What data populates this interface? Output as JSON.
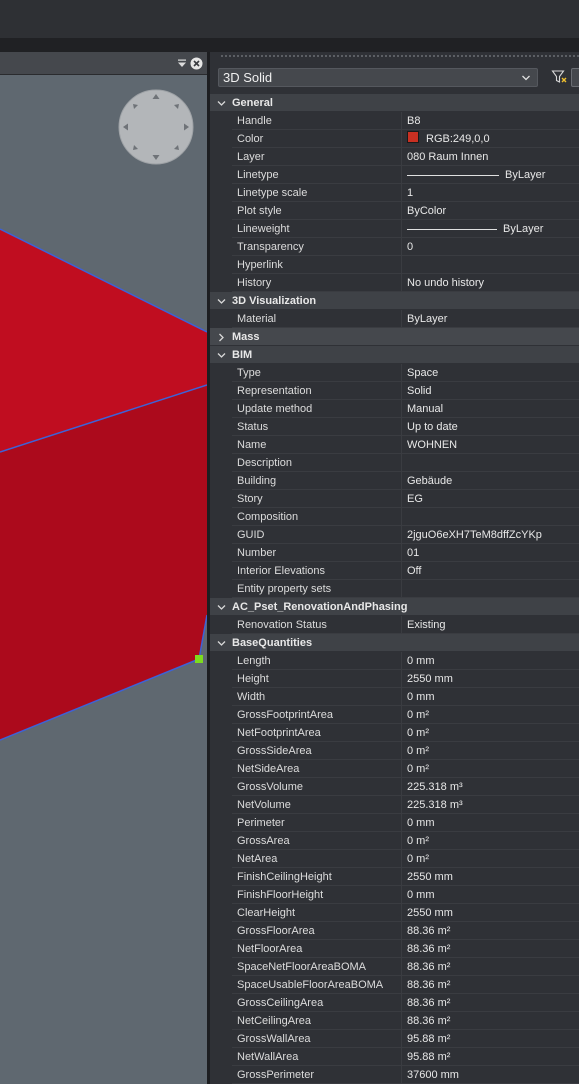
{
  "viewport": {
    "solid_color": "#c00d20",
    "edge_color": "#3d62d8",
    "background": "#5f6870"
  },
  "properties": {
    "selector_value": "3D Solid",
    "sections": [
      {
        "label": "General",
        "expanded": true,
        "rows": [
          {
            "name": "Handle",
            "value": "B8",
            "disabled": true
          },
          {
            "name": "Color",
            "value": "RGB:249,0,0",
            "swatch": "#c93022"
          },
          {
            "name": "Layer",
            "value": "080 Raum Innen"
          },
          {
            "name": "Linetype",
            "value": "ByLayer",
            "line": true
          },
          {
            "name": "Linetype scale",
            "value": "1"
          },
          {
            "name": "Plot style",
            "value": "ByColor",
            "disabled": true
          },
          {
            "name": "Lineweight",
            "value": "ByLayer",
            "line": true
          },
          {
            "name": "Transparency",
            "value": "0"
          },
          {
            "name": "Hyperlink",
            "value": ""
          },
          {
            "name": "History",
            "value": "No undo history"
          }
        ]
      },
      {
        "label": "3D Visualization",
        "expanded": true,
        "rows": [
          {
            "name": "Material",
            "value": "ByLayer"
          }
        ]
      },
      {
        "label": "Mass",
        "expanded": false,
        "rows": []
      },
      {
        "label": "BIM",
        "expanded": true,
        "rows": [
          {
            "name": "Type",
            "value": "Space",
            "disabled": true
          },
          {
            "name": "Representation",
            "value": "Solid"
          },
          {
            "name": "Update method",
            "value": "Manual"
          },
          {
            "name": "Status",
            "value": "Up to date"
          },
          {
            "name": "Name",
            "value": "WOHNEN"
          },
          {
            "name": "Description",
            "value": ""
          },
          {
            "name": "Building",
            "value": "Gebäude"
          },
          {
            "name": "Story",
            "value": "EG"
          },
          {
            "name": "Composition",
            "value": ""
          },
          {
            "name": "GUID",
            "value": "2jguO6eXH7TeM8dffZcYKp",
            "disabled": true
          },
          {
            "name": "Number",
            "value": "01"
          },
          {
            "name": "Interior Elevations",
            "value": "Off",
            "disabled": true
          },
          {
            "name": "Entity property sets",
            "value": ""
          }
        ]
      },
      {
        "label": "AC_Pset_RenovationAndPhasing",
        "expanded": true,
        "rows": [
          {
            "name": "Renovation Status",
            "value": "Existing"
          }
        ]
      },
      {
        "label": "BaseQuantities",
        "expanded": true,
        "rows": [
          {
            "name": "Length",
            "value": "0 mm"
          },
          {
            "name": "Height",
            "value": "2550 mm"
          },
          {
            "name": "Width",
            "value": "0 mm"
          },
          {
            "name": "GrossFootprintArea",
            "value": "0 m²"
          },
          {
            "name": "NetFootprintArea",
            "value": "0 m²"
          },
          {
            "name": "GrossSideArea",
            "value": "0 m²"
          },
          {
            "name": "NetSideArea",
            "value": "0 m²"
          },
          {
            "name": "GrossVolume",
            "value": "225.318 m³"
          },
          {
            "name": "NetVolume",
            "value": "225.318 m³"
          },
          {
            "name": "Perimeter",
            "value": "0 mm"
          },
          {
            "name": "GrossArea",
            "value": "0 m²"
          },
          {
            "name": "NetArea",
            "value": "0 m²"
          },
          {
            "name": "FinishCeilingHeight",
            "value": "2550 mm"
          },
          {
            "name": "FinishFloorHeight",
            "value": "0 mm"
          },
          {
            "name": "ClearHeight",
            "value": "2550 mm"
          },
          {
            "name": "GrossFloorArea",
            "value": "88.36 m²"
          },
          {
            "name": "NetFloorArea",
            "value": "88.36 m²"
          },
          {
            "name": "SpaceNetFloorAreaBOMA",
            "value": "88.36 m²"
          },
          {
            "name": "SpaceUsableFloorAreaBOMA",
            "value": "88.36 m²"
          },
          {
            "name": "GrossCeilingArea",
            "value": "88.36 m²"
          },
          {
            "name": "NetCeilingArea",
            "value": "88.36 m²"
          },
          {
            "name": "GrossWallArea",
            "value": "95.88 m²"
          },
          {
            "name": "NetWallArea",
            "value": "95.88 m²"
          },
          {
            "name": "GrossPerimeter",
            "value": "37600 mm"
          }
        ]
      }
    ]
  }
}
